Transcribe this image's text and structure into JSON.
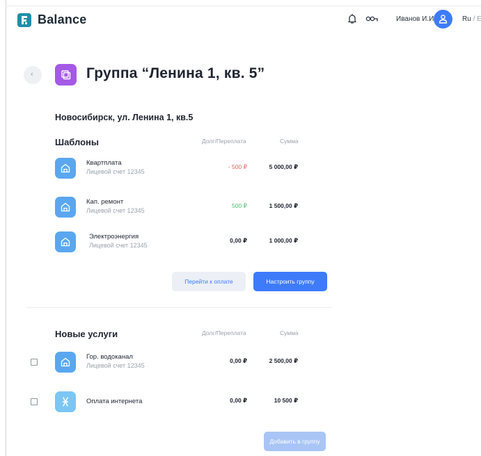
{
  "header": {
    "logo_letter": "F",
    "app_name": "Balance",
    "user_name": "Иванов И.И.",
    "lang_active": "Ru",
    "lang_sep": " / ",
    "lang_other": "En"
  },
  "page": {
    "title": "Группа “Ленина 1, кв. 5”",
    "address": "Новосибирск, ул. Ленина 1, кв.5"
  },
  "templates": {
    "title": "Шаблоны",
    "col_debt": "Долг/Переплата",
    "col_sum": "Сумма",
    "items": [
      {
        "name": "Квартплата",
        "account": "Лицевой счет  12345",
        "debt": "- 500 ₽",
        "sum": "5 000,00 ₽"
      },
      {
        "name": "Кап. ремонт",
        "account": "Лицевой счет  12345",
        "debt": "500 ₽",
        "sum": "1 500,00 ₽"
      },
      {
        "name": "Электроэнергия",
        "account": "Лицевой счет  12345",
        "debt": "0,00 ₽",
        "sum": "1 000,00 ₽"
      }
    ],
    "btn_pay": "Перейти к оплате",
    "btn_setup": "Настроить группу"
  },
  "new_services": {
    "title": "Новые услуги",
    "col_debt": "Долг/Переплата",
    "col_sum": "Сумма",
    "items": [
      {
        "name": "Гор. водоканал",
        "account": "Лицевой счет  12345",
        "debt": "0,00 ₽",
        "sum": "2 500,00 ₽"
      },
      {
        "name": "Оплата интернета",
        "debt": "0,00 ₽",
        "sum": "10 500 ₽"
      }
    ],
    "btn_add": "Добавить в группу"
  },
  "colors": {
    "accent": "#3e7bfa",
    "negative": "#e0605f",
    "positive": "#49b86a",
    "group_icon": "#a45ae6",
    "service_icon": "#5aa7ef"
  }
}
